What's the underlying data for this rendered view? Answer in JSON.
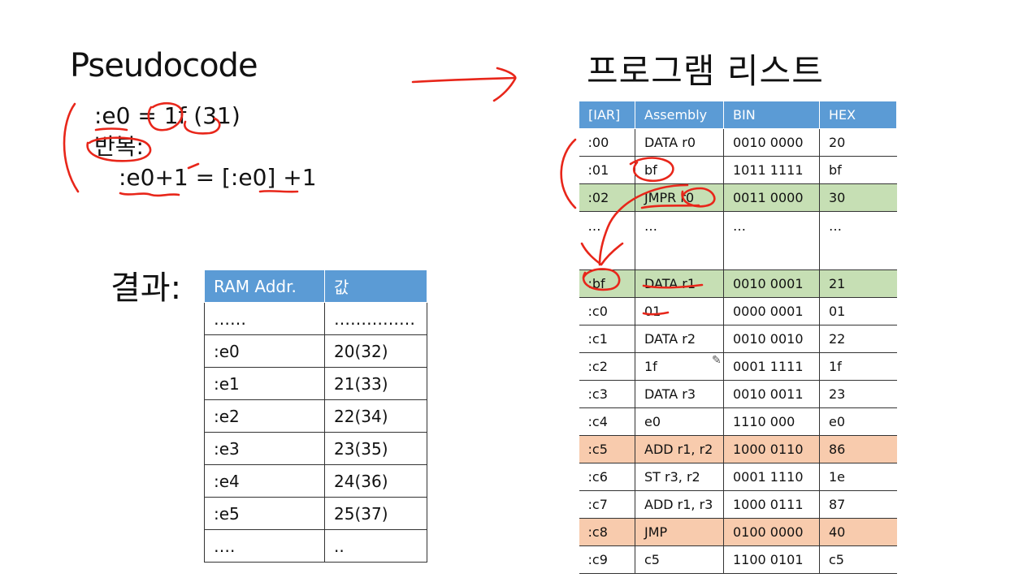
{
  "slide": {
    "title_left": "Pseudocode",
    "title_right": "프로그램 리스트",
    "result_label": "결과:",
    "pseudocode": [
      ":e0 = 1f (31)",
      "반복:",
      ":e0+1 = [:e0] +1"
    ]
  },
  "ram_table": {
    "headers": [
      "RAM Addr.",
      "값"
    ],
    "rows": [
      [
        "……",
        "……………"
      ],
      [
        ":e0",
        "20(32)"
      ],
      [
        ":e1",
        "21(33)"
      ],
      [
        ":e2",
        "22(34)"
      ],
      [
        ":e3",
        "23(35)"
      ],
      [
        ":e4",
        "24(36)"
      ],
      [
        ":e5",
        "25(37)"
      ],
      [
        "….",
        ".."
      ]
    ]
  },
  "program_table": {
    "headers": [
      "[IAR]",
      "Assembly",
      "BIN",
      "HEX"
    ],
    "rows": [
      [
        ":00",
        "DATA r0",
        "0010 0000",
        "20"
      ],
      [
        ":01",
        "bf",
        "1011 1111",
        "bf"
      ],
      [
        ":02",
        "JMPR r0",
        "0011 0000",
        "30"
      ],
      [
        "…",
        "…",
        "…",
        "…"
      ],
      [
        ":bf",
        "DATA r1",
        "0010 0001",
        "21"
      ],
      [
        ":c0",
        "01",
        "0000 0001",
        "01"
      ],
      [
        ":c1",
        "DATA r2",
        "0010 0010",
        "22"
      ],
      [
        ":c2",
        "1f",
        "0001 1111",
        "1f"
      ],
      [
        ":c3",
        "DATA r3",
        "0010 0011",
        "23"
      ],
      [
        ":c4",
        "e0",
        "1110 000",
        "e0"
      ],
      [
        ":c5",
        "ADD r1, r2",
        "1000 0110",
        "86"
      ],
      [
        ":c6",
        "ST r3, r2",
        "0001 1110",
        "1e"
      ],
      [
        ":c7",
        "ADD r1, r3",
        "1000 0111",
        "87"
      ],
      [
        ":c8",
        "JMP",
        "0100 0000",
        "40"
      ],
      [
        ":c9",
        "c5",
        "1100 0101",
        "c5"
      ]
    ]
  },
  "colors": {
    "header_blue": "#5b9bd5",
    "highlight_green": "#c6dfb4",
    "highlight_orange": "#f8cbad",
    "ink_red": "#e8261a"
  }
}
